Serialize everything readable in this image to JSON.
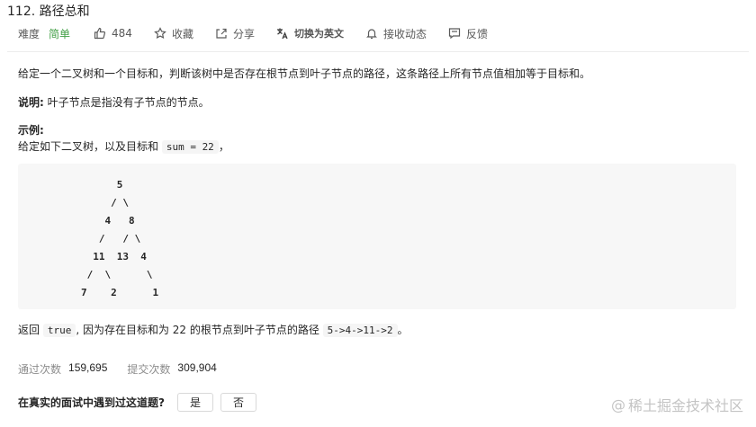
{
  "problem": {
    "title": "112. 路径总和"
  },
  "meta": {
    "difficulty_label": "难度",
    "difficulty_value": "简单",
    "likes": "484",
    "favorite_label": "收藏",
    "share_label": "分享",
    "translate_label": "切换为英文",
    "notify_label": "接收动态",
    "feedback_label": "反馈"
  },
  "description": {
    "text": "给定一个二叉树和一个目标和，判断该树中是否存在根节点到叶子节点的路径，这条路径上所有节点值相加等于目标和。",
    "note_label": "说明:",
    "note_text": " 叶子节点是指没有子节点的节点。",
    "example_title": "示例:",
    "example_text_before": "给定如下二叉树，以及目标和 ",
    "example_code": "sum = 22",
    "example_text_after": "，",
    "tree": "      5\n     / \\\n    4   8\n   /   / \\\n  11  13  4\n /  \\      \\\n7    2      1",
    "result_before": "返回 ",
    "result_code1": "true",
    "result_mid": ", 因为存在目标和为 22 的根节点到叶子节点的路径 ",
    "result_code2": "5->4->11->2",
    "result_after": "。"
  },
  "stats": {
    "accepted_label": "通过次数",
    "accepted_value": "159,695",
    "submitted_label": "提交次数",
    "submitted_value": "309,904"
  },
  "interview": {
    "question": "在真实的面试中遇到过这道题?",
    "yes": "是",
    "no": "否"
  },
  "watermark": {
    "text": "稀土掘金技术社区"
  },
  "colors": {
    "easy": "#43a047",
    "muted": "#8c8c8c"
  }
}
